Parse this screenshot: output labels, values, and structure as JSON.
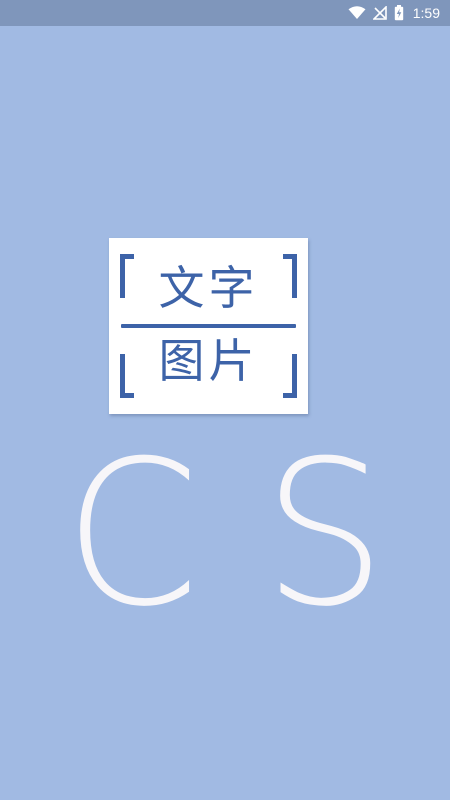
{
  "status_bar": {
    "time": "1:59",
    "icons": [
      "wifi-icon",
      "no-signal-icon",
      "battery-charging-icon"
    ]
  },
  "logo": {
    "line1": "文字",
    "line2": "图片",
    "accent_color": "#3d63a8"
  },
  "brand": {
    "letter1": "C",
    "letter2": "S"
  },
  "colors": {
    "background": "#a1bae3",
    "status_bar": "#7f96bb",
    "brand_text": "#f7f6f9"
  }
}
